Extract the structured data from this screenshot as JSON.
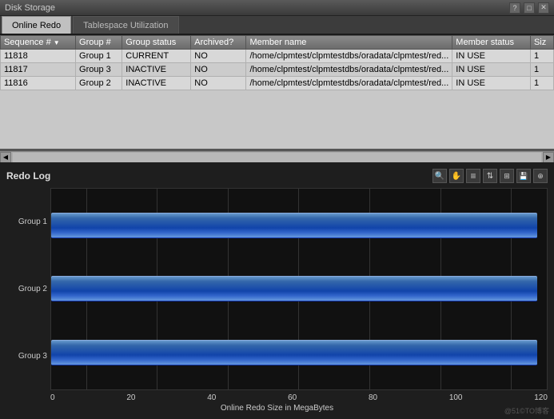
{
  "titleBar": {
    "title": "Disk Storage",
    "icons": [
      "?",
      "□",
      "✕"
    ]
  },
  "tabs": [
    {
      "id": "online-redo",
      "label": "Online Redo",
      "active": true
    },
    {
      "id": "tablespace",
      "label": "Tablespace Utilization",
      "active": false
    }
  ],
  "table": {
    "columns": [
      {
        "id": "sequence",
        "label": "Sequence #",
        "sortable": true
      },
      {
        "id": "group",
        "label": "Group #",
        "sortable": false
      },
      {
        "id": "groupStatus",
        "label": "Group status",
        "sortable": false
      },
      {
        "id": "archived",
        "label": "Archived?",
        "sortable": false
      },
      {
        "id": "memberName",
        "label": "Member name",
        "sortable": false
      },
      {
        "id": "memberStatus",
        "label": "Member status",
        "sortable": false
      },
      {
        "id": "size",
        "label": "Siz",
        "sortable": false
      }
    ],
    "rows": [
      {
        "sequence": "11818",
        "group": "Group 1",
        "groupStatus": "CURRENT",
        "archived": "NO",
        "memberName": "/home/clpmtest/clpmtestdbs/oradata/clpmtest/red...",
        "memberStatus": "IN USE",
        "size": "1"
      },
      {
        "sequence": "11817",
        "group": "Group 3",
        "groupStatus": "INACTIVE",
        "archived": "NO",
        "memberName": "/home/clpmtest/clpmtestdbs/oradata/clpmtest/red...",
        "memberStatus": "IN USE",
        "size": "1"
      },
      {
        "sequence": "11816",
        "group": "Group 2",
        "groupStatus": "INACTIVE",
        "archived": "NO",
        "memberName": "/home/clpmtest/clpmtestdbs/oradata/clpmtest/red...",
        "memberStatus": "IN USE",
        "size": "1"
      }
    ]
  },
  "chart": {
    "title": "Redo Log",
    "xAxisTitle": "Online Redo Size in MegaBytes",
    "xLabels": [
      "0",
      "20",
      "40",
      "60",
      "80",
      "100",
      "120"
    ],
    "groups": [
      {
        "label": "Group 1",
        "widthPercent": 98
      },
      {
        "label": "Group 2",
        "widthPercent": 98
      },
      {
        "label": "Group 3",
        "widthPercent": 98
      }
    ],
    "toolbarIcons": [
      "🔍",
      "✋",
      "≡",
      "⇅",
      "⊞",
      "💾",
      "⊕"
    ]
  },
  "watermark": "@51©TO博客"
}
